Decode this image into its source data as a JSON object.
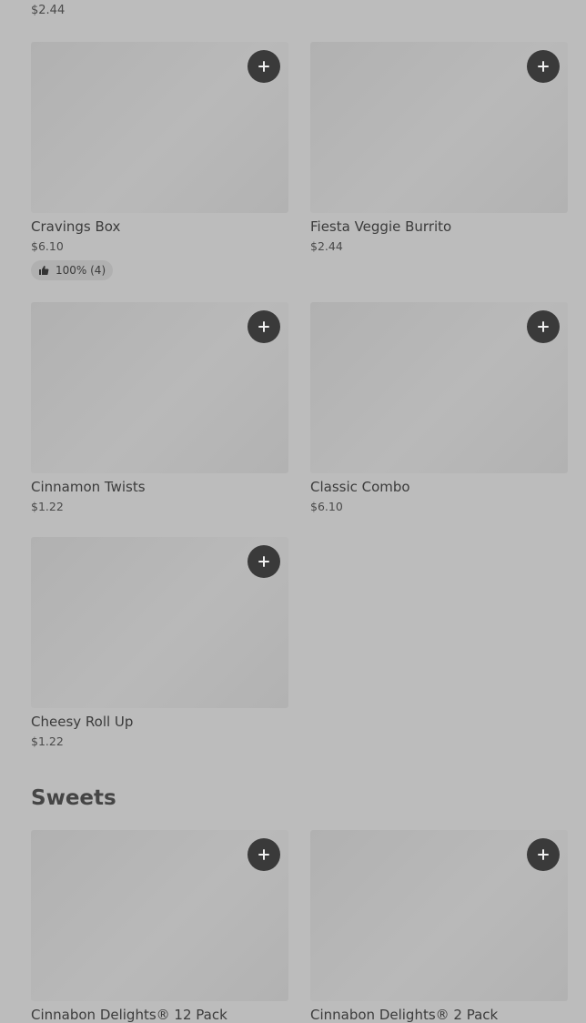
{
  "top_item": {
    "price": "$2.44"
  },
  "items": [
    {
      "name": "Cravings Box",
      "price": "$6.10",
      "rating": "100% (4)"
    },
    {
      "name": "Fiesta Veggie Burrito",
      "price": "$2.44"
    },
    {
      "name": "Cinnamon Twists",
      "price": "$1.22"
    },
    {
      "name": "Classic Combo",
      "price": "$6.10"
    },
    {
      "name": "Cheesy Roll Up",
      "price": "$1.22"
    }
  ],
  "sweets": {
    "title": "Sweets",
    "items": [
      {
        "name": "Cinnabon Delights® 12 Pack"
      },
      {
        "name": "Cinnabon Delights® 2 Pack"
      }
    ]
  },
  "icons": {
    "add": "plus-icon",
    "thumb": "thumbs-up-icon"
  },
  "colors": {
    "overlay_bg": "#bcbcbc",
    "button": "#3a3a3a"
  }
}
